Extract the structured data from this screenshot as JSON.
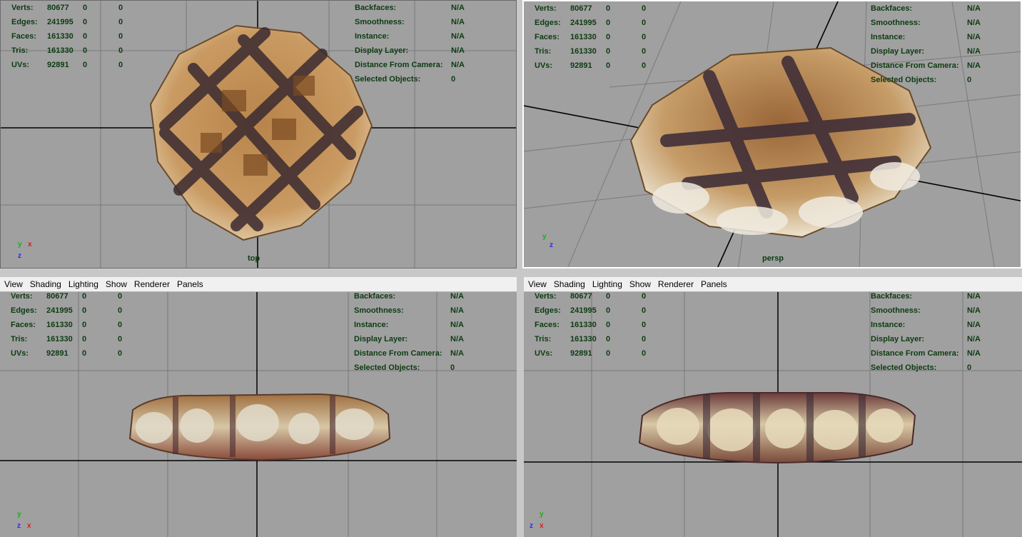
{
  "menu": [
    "View",
    "Shading",
    "Lighting",
    "Show",
    "Renderer",
    "Panels"
  ],
  "hud_left_labels": [
    "Verts:",
    "Edges:",
    "Faces:",
    "Tris:",
    "UVs:"
  ],
  "hud_left_values": [
    [
      "80677",
      "0",
      "0"
    ],
    [
      "241995",
      "0",
      "0"
    ],
    [
      "161330",
      "0",
      "0"
    ],
    [
      "161330",
      "0",
      "0"
    ],
    [
      "92891",
      "0",
      "0"
    ]
  ],
  "hud_right_labels": [
    "Backfaces:",
    "Smoothness:",
    "Instance:",
    "Display Layer:",
    "Distance From Camera:",
    "Selected Objects:"
  ],
  "hud_right_values": [
    "N/A",
    "N/A",
    "N/A",
    "N/A",
    "N/A",
    "0"
  ],
  "panels": {
    "top_left": {
      "camera": "top"
    },
    "top_right": {
      "camera": "persp"
    },
    "bottom_left": {
      "camera": ""
    },
    "bottom_right": {
      "camera": ""
    }
  },
  "axis_labels": {
    "x": "x",
    "y": "y",
    "z": "z"
  },
  "colors": {
    "viewport_bg": "#a0a0a0",
    "grid_line": "#787878",
    "grid_axis": "#000000",
    "hud_text": "#0d3b12",
    "active_border": "#ffffff"
  },
  "icons": {
    "axis_gizmo": "view-axis-icon",
    "model": "waffle-mesh-icon"
  }
}
